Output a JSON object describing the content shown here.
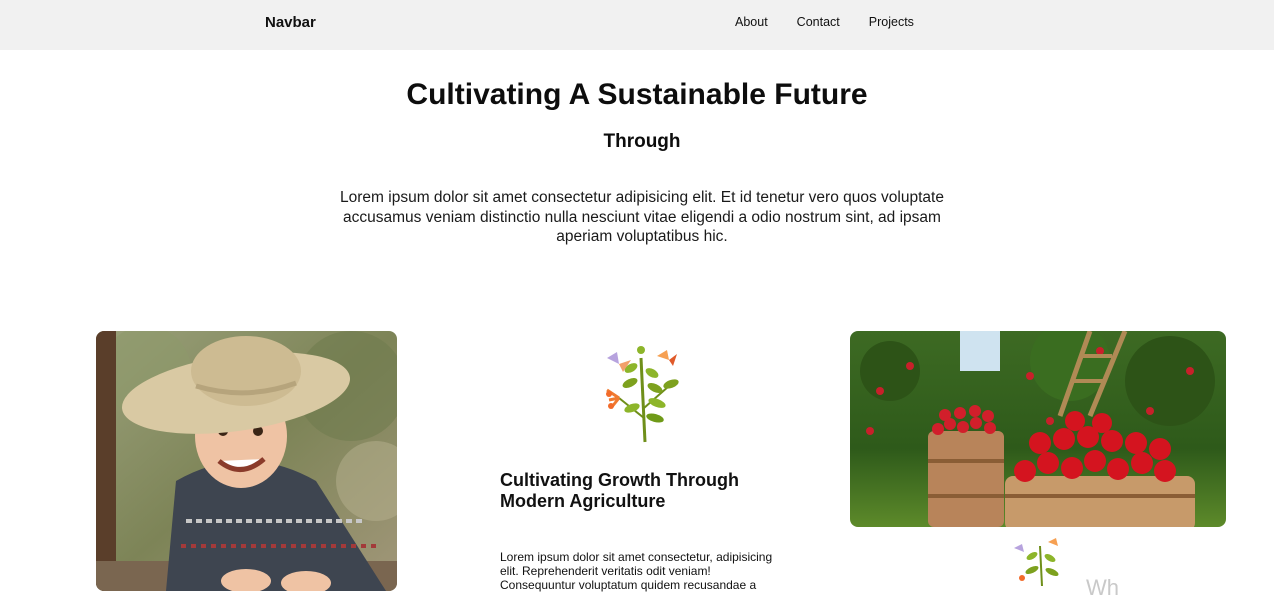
{
  "navbar": {
    "brand": "Navbar",
    "links": [
      "About",
      "Contact",
      "Projects"
    ]
  },
  "hero": {
    "title": "Cultivating A Sustainable Future",
    "subtitle": "Through",
    "text": "Lorem ipsum dolor sit amet consectetur adipisicing elit. Et id tenetur vero quos voluptate accusamus veniam distinctio nulla nesciunt vitae eligendi a odio nostrum sint, ad ipsam aperiam voluptatibus hic."
  },
  "feature": {
    "title": "Cultivating Growth Through Modern Agriculture",
    "text": "Lorem ipsum dolor sit amet consectetur, adipisicing elit. Reprehenderit veritatis odit veniam! Consequuntur voluptatum quidem recusandae a"
  },
  "right_column": {
    "partial_heading": "Wh"
  },
  "colors": {
    "navbar_bg": "#f1f1f1",
    "text": "#111111",
    "leaf_green": "#7da11e",
    "flower_orange": "#f07a30"
  },
  "icons": [
    "plant-illustration",
    "plant-illustration-small"
  ]
}
